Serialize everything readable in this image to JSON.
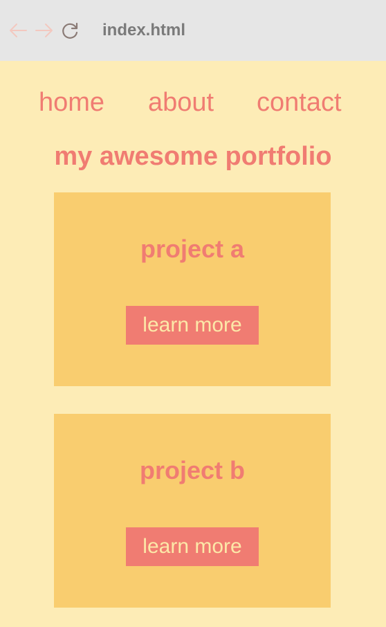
{
  "browser": {
    "tab_title": "index.html"
  },
  "nav": {
    "items": [
      {
        "label": "home"
      },
      {
        "label": "about"
      },
      {
        "label": "contact"
      }
    ]
  },
  "site": {
    "title": "my awesome portfolio"
  },
  "projects": [
    {
      "title": "project a",
      "button_label": "learn more"
    },
    {
      "title": "project b",
      "button_label": "learn more"
    }
  ],
  "colors": {
    "page_background": "#fdecb6",
    "card_background": "#f9cd6f",
    "accent": "#f07c72",
    "button_text": "#fce8a8",
    "browser_bar": "#e6e6e6"
  },
  "icons": {
    "back": "back-arrow-icon",
    "forward": "forward-arrow-icon",
    "reload": "reload-icon"
  }
}
